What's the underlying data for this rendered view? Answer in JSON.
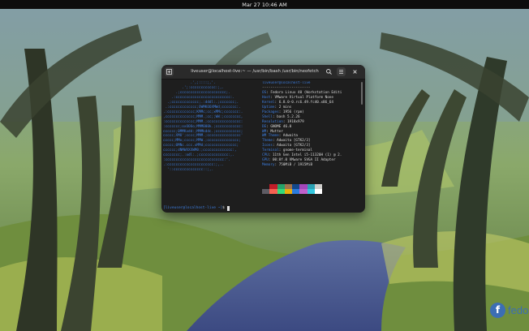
{
  "topbar": {
    "clock": "Mar 27  10:46 AM"
  },
  "terminal": {
    "title": "liveuser@localhost-live:~ — /usr/bin/bash /usr/bin/neofetch",
    "new_tab_icon": "new-tab-icon",
    "search_icon": "search-icon",
    "menu_icon": "hamburger-menu-icon",
    "close_icon": "close-icon",
    "logo_ascii": "             .',;::::;,'.\n         .';:cccccccccccc:;,.\n      .;cccccccccccccccccccccc;.\n    .:cccccccccccccccccccccccccc:.\n  .;ccccccccccccc;.:dddl:.;ccccccc;.\n .:ccccccccccccc;OWMKOOXMWd;ccccccc:.\n.:ccccccccccccc;KMMc;cc;xMMc;ccccccc:.\n,cccccccccccccc;MMM.;cc;;WW:;cccccccc,\n:cccccccccccccc;MMM.;cccccccccccccccc:\n:ccccccc;oxOOOo;MMM000k.;cccccccccccc:\ncccccc;0MMKxdd:;MMMkddc.;cccccccccccc;\nccccc;XMO';cccc;MMM.;cccccccccccccccc'\nccccc;MMo;ccccc;MMW.;ccccccccccccccc;\nccccc;0MNc.ccc.xMMd;ccccccccccccccc;\ncccccc;dNMWXXXWM0:;cccccccccccccc:,\ncccccccc;.:odl:.;cccccccccccccc:,.\n:cccccccccccccccccccccccccccc:'.\n.:cccccccccccccccccccccc:;,..\n  '::cccccccccccccc::;,.",
    "info_header": "liveuser@localhost-live",
    "info_separator": "-----------------------",
    "info": [
      {
        "key": "OS",
        "value": "Fedora Linux 40 (Workstation Editi"
      },
      {
        "key": "Host",
        "value": "VMware Virtual Platform None"
      },
      {
        "key": "Kernel",
        "value": "6.8.0-0.rc6.49.fc40.x86_64"
      },
      {
        "key": "Uptime",
        "value": "2 mins"
      },
      {
        "key": "Packages",
        "value": "1956 (rpm)"
      },
      {
        "key": "Shell",
        "value": "bash 5.2.26"
      },
      {
        "key": "Resolution",
        "value": "1918x979"
      },
      {
        "key": "DE",
        "value": "GNOME 46.0"
      },
      {
        "key": "WM",
        "value": "Mutter"
      },
      {
        "key": "WM Theme",
        "value": "Adwaita"
      },
      {
        "key": "Theme",
        "value": "Adwaita [GTK2/3]"
      },
      {
        "key": "Icons",
        "value": "Adwaita [GTK2/3]"
      },
      {
        "key": "Terminal",
        "value": "gnome-terminal"
      },
      {
        "key": "CPU",
        "value": "11th Gen Intel i5-11320H (1) @ 2."
      },
      {
        "key": "GPU",
        "value": "00:0f.0 VMware SVGA II Adapter"
      },
      {
        "key": "Memory",
        "value": "750MiB / 1915MiB"
      }
    ],
    "palette_top": [
      "#1e1e1e",
      "#c01c28",
      "#26a269",
      "#a2734c",
      "#12488b",
      "#a347ba",
      "#2aa1b3",
      "#d0cfcc"
    ],
    "palette_bottom": [
      "#5e5c64",
      "#f66151",
      "#33da7a",
      "#e9ad0c",
      "#2a7bde",
      "#c061cb",
      "#33c7de",
      "#ffffff"
    ],
    "prompt_user": "[liveuser@localhost-live ~]",
    "prompt_symbol": "$"
  },
  "brand": {
    "letter": "f",
    "text": "fedo"
  }
}
